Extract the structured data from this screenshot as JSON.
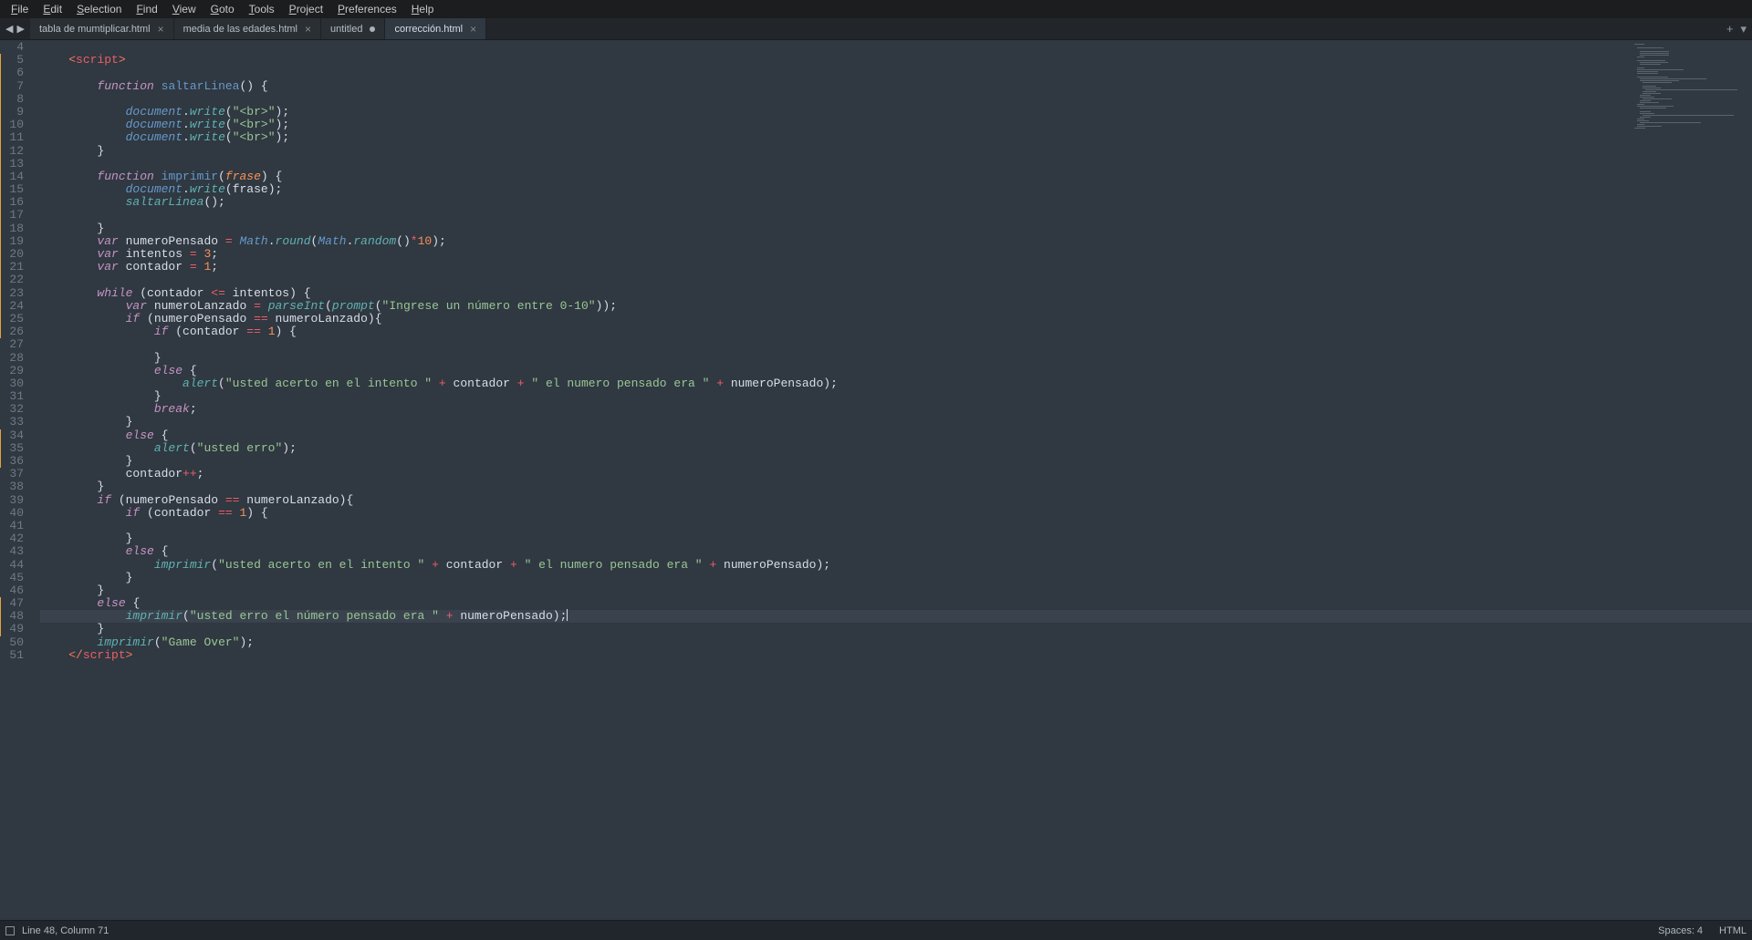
{
  "menu": {
    "items": [
      "File",
      "Edit",
      "Selection",
      "Find",
      "View",
      "Goto",
      "Tools",
      "Project",
      "Preferences",
      "Help"
    ]
  },
  "nav": {
    "back": "◀",
    "forward": "▶"
  },
  "tabs": [
    {
      "label": "tabla de mumtiplicar.html",
      "active": false,
      "dirty": false
    },
    {
      "label": "media de las edades.html",
      "active": false,
      "dirty": false
    },
    {
      "label": "untitled",
      "active": false,
      "dirty": true
    },
    {
      "label": "corrección.html",
      "active": true,
      "dirty": false
    }
  ],
  "tabrow_right": {
    "plus": "+",
    "menu": "▾"
  },
  "gutter": {
    "start": 4,
    "end": 51,
    "modified": [
      5,
      6,
      7,
      8,
      9,
      10,
      11,
      12,
      13,
      14,
      15,
      16,
      17,
      18,
      19,
      20,
      21,
      22,
      23,
      24,
      25,
      26,
      34,
      35,
      36,
      47,
      48,
      49
    ]
  },
  "status": {
    "line_col": "Line 48, Column 71",
    "spaces": "Spaces: 4",
    "lang": "HTML"
  },
  "cursor": {
    "line": 48,
    "col": 71
  },
  "code": [
    {
      "n": 4,
      "i": 0,
      "tok": []
    },
    {
      "n": 5,
      "i": 1,
      "tok": [
        [
          "<",
          "c-p"
        ],
        [
          "script",
          "c-t"
        ],
        [
          ">",
          "c-p"
        ]
      ]
    },
    {
      "n": 6,
      "i": 0,
      "tok": []
    },
    {
      "n": 7,
      "i": 2,
      "tok": [
        [
          "function",
          "c-kw"
        ],
        [
          " ",
          ""
        ],
        [
          "saltarLinea",
          "c-fd"
        ],
        [
          "() {",
          "c-br"
        ]
      ]
    },
    {
      "n": 8,
      "i": 0,
      "tok": []
    },
    {
      "n": 9,
      "i": 3,
      "tok": [
        [
          "document",
          "c-ob"
        ],
        [
          ".",
          "c-v"
        ],
        [
          "write",
          "c-fn"
        ],
        [
          "(",
          "c-br"
        ],
        [
          "\"<br>\"",
          "c-s"
        ],
        [
          ")",
          "c-br"
        ],
        [
          ";",
          "c-v"
        ]
      ]
    },
    {
      "n": 10,
      "i": 3,
      "tok": [
        [
          "document",
          "c-ob"
        ],
        [
          ".",
          "c-v"
        ],
        [
          "write",
          "c-fn"
        ],
        [
          "(",
          "c-br"
        ],
        [
          "\"<br>\"",
          "c-s"
        ],
        [
          ")",
          "c-br"
        ],
        [
          ";",
          "c-v"
        ]
      ]
    },
    {
      "n": 11,
      "i": 3,
      "tok": [
        [
          "document",
          "c-ob"
        ],
        [
          ".",
          "c-v"
        ],
        [
          "write",
          "c-fn"
        ],
        [
          "(",
          "c-br"
        ],
        [
          "\"<br>\"",
          "c-s"
        ],
        [
          ")",
          "c-br"
        ],
        [
          ";",
          "c-v"
        ]
      ]
    },
    {
      "n": 12,
      "i": 2,
      "tok": [
        [
          "}",
          "c-br"
        ]
      ]
    },
    {
      "n": 13,
      "i": 0,
      "tok": []
    },
    {
      "n": 14,
      "i": 2,
      "tok": [
        [
          "function",
          "c-kw"
        ],
        [
          " ",
          ""
        ],
        [
          "imprimir",
          "c-fd"
        ],
        [
          "(",
          "c-br"
        ],
        [
          "frase",
          "c-prm"
        ],
        [
          ") {",
          "c-br"
        ]
      ]
    },
    {
      "n": 15,
      "i": 3,
      "tok": [
        [
          "document",
          "c-ob"
        ],
        [
          ".",
          "c-v"
        ],
        [
          "write",
          "c-fn"
        ],
        [
          "(",
          "c-br"
        ],
        [
          "frase",
          "c-v"
        ],
        [
          ")",
          "c-br"
        ],
        [
          ";",
          "c-v"
        ]
      ]
    },
    {
      "n": 16,
      "i": 3,
      "tok": [
        [
          "saltarLinea",
          "c-fn"
        ],
        [
          "();",
          "c-br"
        ]
      ]
    },
    {
      "n": 17,
      "i": 0,
      "tok": []
    },
    {
      "n": 18,
      "i": 2,
      "tok": [
        [
          "}",
          "c-br"
        ]
      ]
    },
    {
      "n": 19,
      "i": 2,
      "tok": [
        [
          "var",
          "c-kw"
        ],
        [
          " numeroPensado ",
          "c-v"
        ],
        [
          "=",
          "c-op"
        ],
        [
          " ",
          ""
        ],
        [
          "Math",
          "c-ob"
        ],
        [
          ".",
          "c-v"
        ],
        [
          "round",
          "c-fn"
        ],
        [
          "(",
          "c-br"
        ],
        [
          "Math",
          "c-ob"
        ],
        [
          ".",
          "c-v"
        ],
        [
          "random",
          "c-fn"
        ],
        [
          "()",
          "c-br"
        ],
        [
          "*",
          "c-op"
        ],
        [
          "10",
          "c-n"
        ],
        [
          ")",
          "c-br"
        ],
        [
          ";",
          "c-v"
        ]
      ]
    },
    {
      "n": 20,
      "i": 2,
      "tok": [
        [
          "var",
          "c-kw"
        ],
        [
          " intentos ",
          "c-v"
        ],
        [
          "=",
          "c-op"
        ],
        [
          " ",
          ""
        ],
        [
          "3",
          "c-n"
        ],
        [
          ";",
          "c-v"
        ]
      ]
    },
    {
      "n": 21,
      "i": 2,
      "tok": [
        [
          "var",
          "c-kw"
        ],
        [
          " contador ",
          "c-v"
        ],
        [
          "=",
          "c-op"
        ],
        [
          " ",
          ""
        ],
        [
          "1",
          "c-n"
        ],
        [
          ";",
          "c-v"
        ]
      ]
    },
    {
      "n": 22,
      "i": 0,
      "tok": []
    },
    {
      "n": 23,
      "i": 2,
      "tok": [
        [
          "while",
          "c-kw"
        ],
        [
          " (contador ",
          "c-v"
        ],
        [
          "<=",
          "c-op"
        ],
        [
          " intentos) {",
          "c-v"
        ]
      ]
    },
    {
      "n": 24,
      "i": 3,
      "tok": [
        [
          "var",
          "c-kw"
        ],
        [
          " numeroLanzado ",
          "c-v"
        ],
        [
          "=",
          "c-op"
        ],
        [
          " ",
          ""
        ],
        [
          "parseInt",
          "c-fn"
        ],
        [
          "(",
          "c-br"
        ],
        [
          "prompt",
          "c-fn"
        ],
        [
          "(",
          "c-br"
        ],
        [
          "\"Ingrese un número entre 0-10\"",
          "c-s"
        ],
        [
          "))",
          "c-br"
        ],
        [
          ";",
          "c-v"
        ]
      ]
    },
    {
      "n": 25,
      "i": 3,
      "tok": [
        [
          "if",
          "c-kw"
        ],
        [
          " (numeroPensado ",
          "c-v"
        ],
        [
          "==",
          "c-op"
        ],
        [
          " numeroLanzado){",
          "c-v"
        ]
      ]
    },
    {
      "n": 26,
      "i": 4,
      "tok": [
        [
          "if",
          "c-kw"
        ],
        [
          " (contador ",
          "c-v"
        ],
        [
          "==",
          "c-op"
        ],
        [
          " ",
          ""
        ],
        [
          "1",
          "c-n"
        ],
        [
          ") {",
          "c-v"
        ]
      ]
    },
    {
      "n": 27,
      "i": 0,
      "tok": []
    },
    {
      "n": 28,
      "i": 4,
      "tok": [
        [
          "}",
          "c-br"
        ]
      ]
    },
    {
      "n": 29,
      "i": 4,
      "tok": [
        [
          "else",
          "c-kw"
        ],
        [
          " {",
          "c-br"
        ]
      ]
    },
    {
      "n": 30,
      "i": 5,
      "tok": [
        [
          "alert",
          "c-fn"
        ],
        [
          "(",
          "c-br"
        ],
        [
          "\"usted acerto en el intento \"",
          "c-s"
        ],
        [
          " ",
          ""
        ],
        [
          "+",
          "c-op"
        ],
        [
          " contador ",
          "c-v"
        ],
        [
          "+",
          "c-op"
        ],
        [
          " ",
          ""
        ],
        [
          "\" el numero pensado era \"",
          "c-s"
        ],
        [
          " ",
          ""
        ],
        [
          "+",
          "c-op"
        ],
        [
          " numeroPensado)",
          "c-v"
        ],
        [
          ";",
          "c-v"
        ]
      ]
    },
    {
      "n": 31,
      "i": 4,
      "tok": [
        [
          "}",
          "c-br"
        ]
      ]
    },
    {
      "n": 32,
      "i": 4,
      "tok": [
        [
          "break",
          "c-kw"
        ],
        [
          ";",
          "c-v"
        ]
      ]
    },
    {
      "n": 33,
      "i": 3,
      "tok": [
        [
          "}",
          "c-br"
        ]
      ]
    },
    {
      "n": 34,
      "i": 3,
      "tok": [
        [
          "else",
          "c-kw"
        ],
        [
          " {",
          "c-br"
        ]
      ]
    },
    {
      "n": 35,
      "i": 4,
      "tok": [
        [
          "alert",
          "c-fn"
        ],
        [
          "(",
          "c-br"
        ],
        [
          "\"usted erro\"",
          "c-s"
        ],
        [
          ")",
          "c-br"
        ],
        [
          ";",
          "c-v"
        ]
      ]
    },
    {
      "n": 36,
      "i": 3,
      "tok": [
        [
          "}",
          "c-br"
        ]
      ]
    },
    {
      "n": 37,
      "i": 3,
      "tok": [
        [
          "contador",
          "c-v"
        ],
        [
          "++",
          "c-op"
        ],
        [
          ";",
          "c-v"
        ]
      ]
    },
    {
      "n": 38,
      "i": 2,
      "tok": [
        [
          "}",
          "c-br"
        ]
      ]
    },
    {
      "n": 39,
      "i": 2,
      "tok": [
        [
          "if",
          "c-kw"
        ],
        [
          " (numeroPensado ",
          "c-v"
        ],
        [
          "==",
          "c-op"
        ],
        [
          " numeroLanzado){",
          "c-v"
        ]
      ]
    },
    {
      "n": 40,
      "i": 3,
      "tok": [
        [
          "if",
          "c-kw"
        ],
        [
          " (contador ",
          "c-v"
        ],
        [
          "==",
          "c-op"
        ],
        [
          " ",
          ""
        ],
        [
          "1",
          "c-n"
        ],
        [
          ") {",
          "c-v"
        ]
      ]
    },
    {
      "n": 41,
      "i": 0,
      "tok": []
    },
    {
      "n": 42,
      "i": 3,
      "tok": [
        [
          "}",
          "c-br"
        ]
      ]
    },
    {
      "n": 43,
      "i": 3,
      "tok": [
        [
          "else",
          "c-kw"
        ],
        [
          " {",
          "c-br"
        ]
      ]
    },
    {
      "n": 44,
      "i": 4,
      "tok": [
        [
          "imprimir",
          "c-fn"
        ],
        [
          "(",
          "c-br"
        ],
        [
          "\"usted acerto en el intento \"",
          "c-s"
        ],
        [
          " ",
          ""
        ],
        [
          "+",
          "c-op"
        ],
        [
          " contador ",
          "c-v"
        ],
        [
          "+",
          "c-op"
        ],
        [
          " ",
          ""
        ],
        [
          "\" el numero pensado era \"",
          "c-s"
        ],
        [
          " ",
          ""
        ],
        [
          "+",
          "c-op"
        ],
        [
          " numeroPensado)",
          "c-v"
        ],
        [
          ";",
          "c-v"
        ]
      ]
    },
    {
      "n": 45,
      "i": 3,
      "tok": [
        [
          "}",
          "c-br"
        ]
      ]
    },
    {
      "n": 46,
      "i": 2,
      "tok": [
        [
          "}",
          "c-br"
        ]
      ]
    },
    {
      "n": 47,
      "i": 2,
      "tok": [
        [
          "else",
          "c-kw"
        ],
        [
          " {",
          "c-br"
        ]
      ]
    },
    {
      "n": 48,
      "i": 3,
      "tok": [
        [
          "imprimir",
          "c-fn"
        ],
        [
          "(",
          "c-br"
        ],
        [
          "\"usted erro el número pensado era \"",
          "c-s"
        ],
        [
          " ",
          ""
        ],
        [
          "+",
          "c-op"
        ],
        [
          " numeroPensado)",
          "c-v"
        ],
        [
          ";",
          "c-v"
        ]
      ],
      "cursorAfter": true
    },
    {
      "n": 49,
      "i": 2,
      "tok": [
        [
          "}",
          "c-br"
        ]
      ]
    },
    {
      "n": 50,
      "i": 2,
      "tok": [
        [
          "imprimir",
          "c-fn"
        ],
        [
          "(",
          "c-br"
        ],
        [
          "\"Game Over\"",
          "c-s"
        ],
        [
          ")",
          "c-br"
        ],
        [
          ";",
          "c-v"
        ]
      ]
    },
    {
      "n": 51,
      "i": 1,
      "tok": [
        [
          "</",
          "c-p"
        ],
        [
          "script",
          "c-t"
        ],
        [
          ">",
          "c-p"
        ]
      ]
    }
  ]
}
